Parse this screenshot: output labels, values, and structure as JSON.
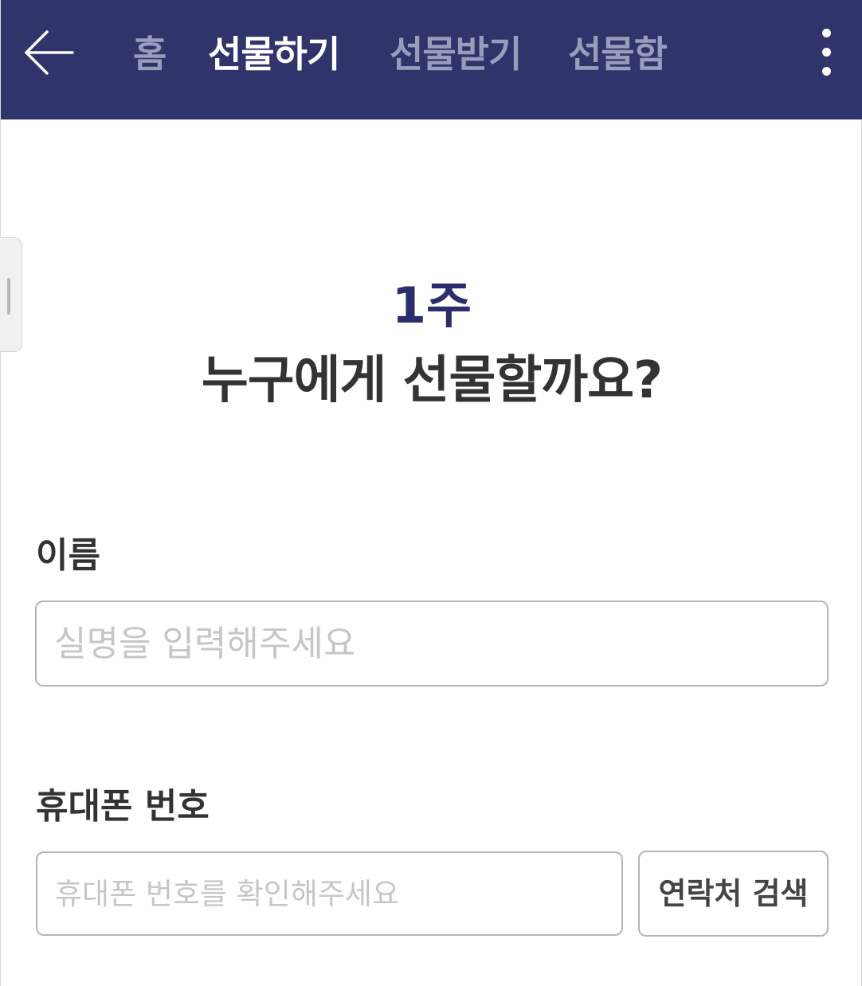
{
  "header": {
    "back_icon": "arrow-left-icon",
    "tabs": [
      {
        "label": "홈",
        "active": false
      },
      {
        "label": "선물하기",
        "active": true
      },
      {
        "label": "선물받기",
        "active": false
      },
      {
        "label": "선물함",
        "active": false
      }
    ],
    "more_icon": "more-vertical-icon"
  },
  "main": {
    "period": "1주",
    "question": "누구에게 선물할까요?",
    "name_label": "이름",
    "name_placeholder": "실명을 입력해주세요",
    "phone_label": "휴대폰 번호",
    "phone_placeholder": "휴대폰 번호를 확인해주세요",
    "contact_search_label": "연락처 검색"
  },
  "colors": {
    "header_bg": "#31336b",
    "accent": "#2b2d6c",
    "inactive_tab": "#9a9cbc",
    "active_tab": "#ffffff",
    "input_border": "#b5b5b5",
    "placeholder": "#c6c6c6"
  }
}
